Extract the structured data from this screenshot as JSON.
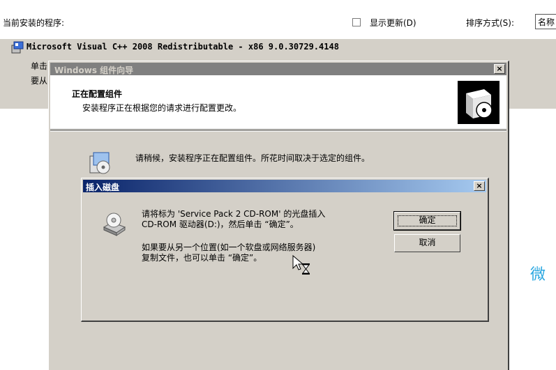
{
  "toolbar": {
    "installed_label": "当前安装的程序:",
    "show_updates_label": "显示更新(D)",
    "sort_by_label": "排序方式(S):",
    "sort_by_value": "名称"
  },
  "program": {
    "name": "Microsoft Visual C++ 2008 Redistributable - x86 9.0.30729.4148",
    "detail_1": "单击",
    "detail_2": "要从"
  },
  "wizard": {
    "title": "Windows 组件向导",
    "header_title": "正在配置组件",
    "header_subtitle": "安装程序正在根据您的请求进行配置更改。",
    "wait_text": "请稍候，安装程序正在配置组件。所花时间取决于选定的组件。"
  },
  "insert_disk": {
    "title": "插入磁盘",
    "msg_line_1": "请将标为 'Service Pack 2 CD-ROM' 的光盘插入",
    "msg_line_2": "CD-ROM 驱动器(D:)，然后单击 “确定”。",
    "msg_line_3": "如果要从另一个位置(如一个软盘或网络服务器)",
    "msg_line_4": "复制文件，也可以单击 “确定”。",
    "ok_label": "确定",
    "cancel_label": "取消"
  },
  "close_glyph": "×",
  "watermark": "微",
  "icons": [
    "program-icon",
    "box-disc-icon",
    "wizard-wait-icon",
    "cd-drive-icon",
    "cursor-icon",
    "close-icon"
  ]
}
